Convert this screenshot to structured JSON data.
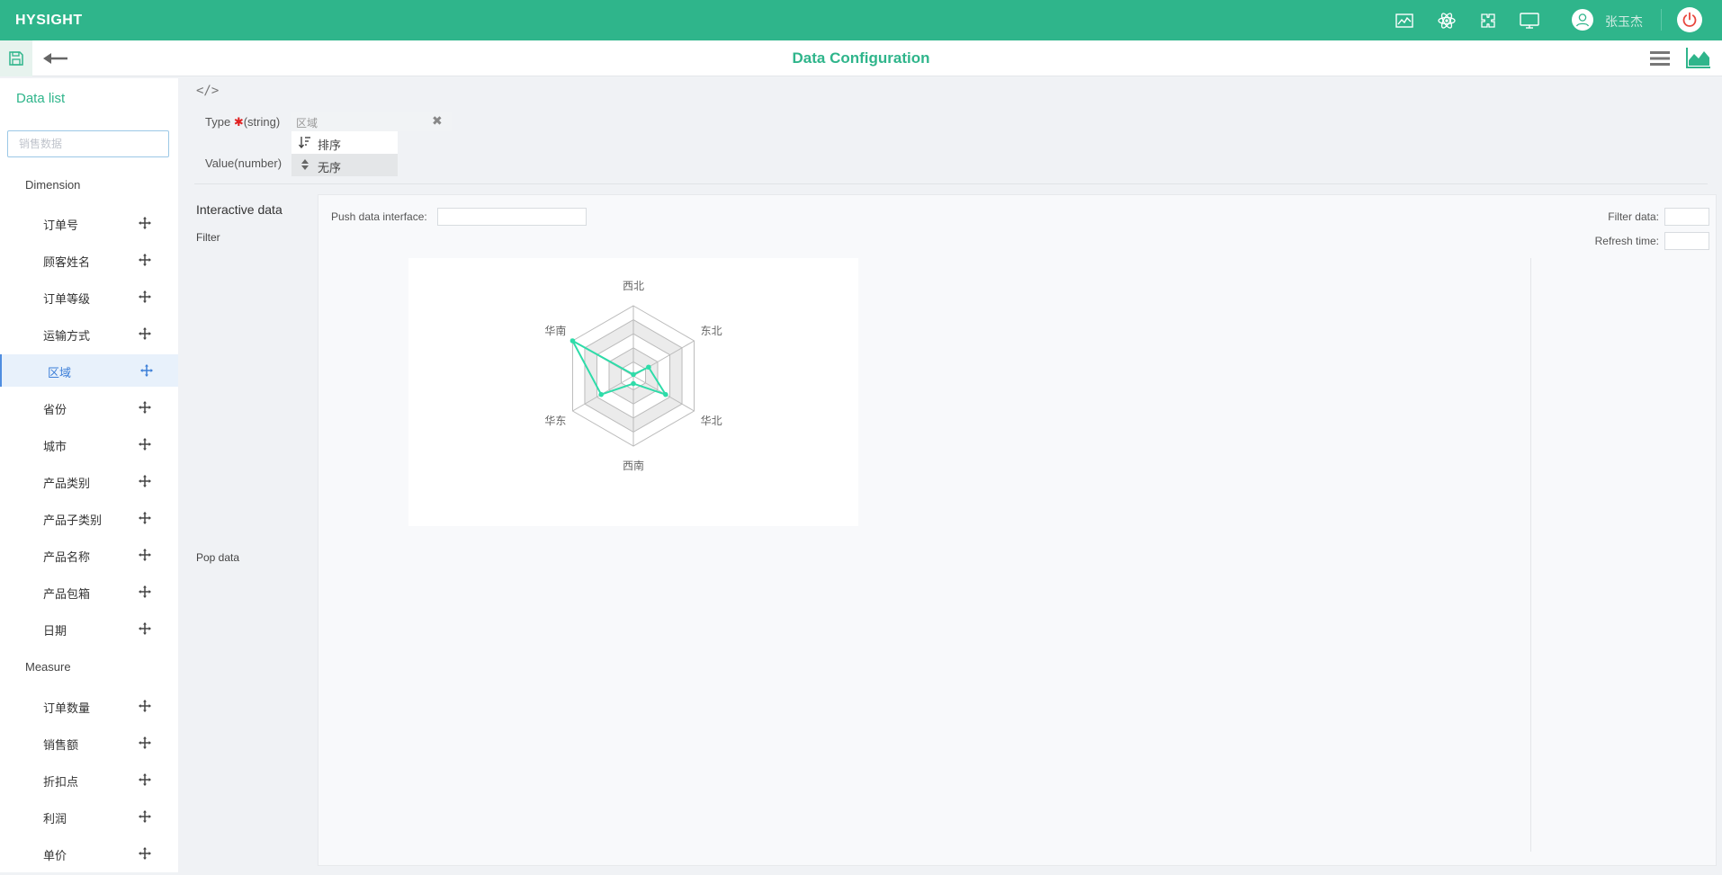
{
  "app": {
    "name": "HYSIGHT",
    "user": "张玉杰"
  },
  "header": {
    "title": "Data Configuration"
  },
  "topbar_icons": [
    "chart-line-icon",
    "atom-icon",
    "puzzle-icon",
    "monitor-icon"
  ],
  "sidebar": {
    "title": "Data list",
    "search_placeholder": "销售数据",
    "dimension_label": "Dimension",
    "dimensions": [
      "订单号",
      "顾客姓名",
      "订单等级",
      "运输方式",
      "区域",
      "省份",
      "城市",
      "产品类别",
      "产品子类别",
      "产品名称",
      "产品包箱",
      "日期"
    ],
    "active_item": "区域",
    "measure_label": "Measure",
    "measures": [
      "订单数量",
      "销售额",
      "折扣点",
      "利润",
      "单价"
    ]
  },
  "config": {
    "code_icon": "</>",
    "type_label": "Type",
    "type_required": "✱",
    "type_hint": "(string)",
    "type_value": "区域",
    "value_label": "Value(number)",
    "sort_options": [
      {
        "label": "排序",
        "icon": "sort-icon"
      },
      {
        "label": "无序",
        "icon": "unsorted-icon"
      }
    ],
    "selected_sort": "无序"
  },
  "interactive": {
    "title": "Interactive data",
    "filter_label": "Filter",
    "pop_label": "Pop data",
    "push_label": "Push data interface:",
    "filter_data_label": "Filter data:",
    "refresh_label": "Refresh time:"
  },
  "colors": {
    "brand": "#2fb58b",
    "series": "#2edca9",
    "active": "#3d7fd8",
    "power": "#e8453c"
  },
  "chart_data": {
    "type": "radar",
    "indicators": [
      "西北",
      "东北",
      "华北",
      "西南",
      "华东",
      "华南"
    ],
    "max": 1,
    "series": [
      {
        "values": [
          0.02,
          0.25,
          0.53,
          0.11,
          0.53,
          1.0
        ]
      }
    ],
    "split_number": 5,
    "split_area": true
  }
}
